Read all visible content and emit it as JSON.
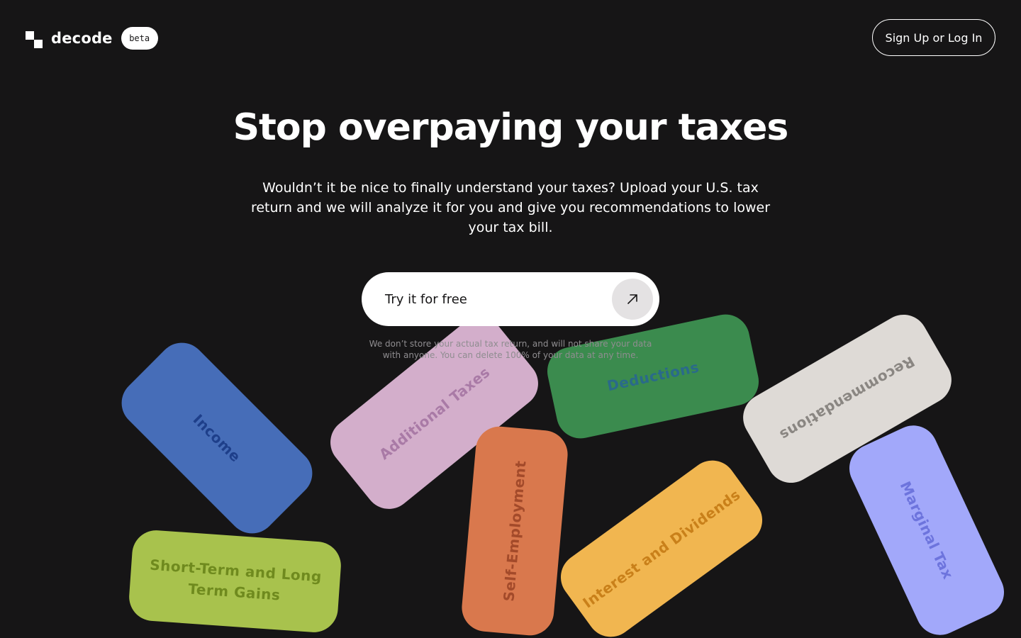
{
  "header": {
    "brand": "decode",
    "badge": "beta",
    "auth_button": "Sign Up or Log In"
  },
  "hero": {
    "title": "Stop overpaying your taxes",
    "subtitle": "Wouldn’t it be nice to finally understand your taxes? Upload your U.S. tax return and we will analyze it for you and give you recommendations to lower your tax bill."
  },
  "cta": {
    "label": "Try it for free",
    "icon": "arrow-up-right-icon"
  },
  "disclaimer": "We don’t store your actual tax return, and will not share your data with anyone. You can delete 100% of your data at any time.",
  "cards": [
    {
      "label": "Income",
      "color": "#466db8",
      "text_color": "#1e3f8a"
    },
    {
      "label": "Additional Taxes",
      "color": "#d3aecb",
      "text_color": "#a97aa6"
    },
    {
      "label": "Deductions",
      "color": "#3b8b4e",
      "text_color": "#2a6a8a"
    },
    {
      "label": "Recommendations",
      "color": "#dedad6",
      "text_color": "#8a8682"
    },
    {
      "label": "Self-Employment",
      "color": "#d9784d",
      "text_color": "#a34a2a"
    },
    {
      "label": "Interest and Dividends",
      "color": "#f1b650",
      "text_color": "#c9801a"
    },
    {
      "label": "Marginal Tax",
      "color": "#a2a8fa",
      "text_color": "#6d74dd"
    },
    {
      "label": "Short-Term and Long Term Gains",
      "color": "#a8c24d",
      "text_color": "#6f8a1e"
    }
  ]
}
